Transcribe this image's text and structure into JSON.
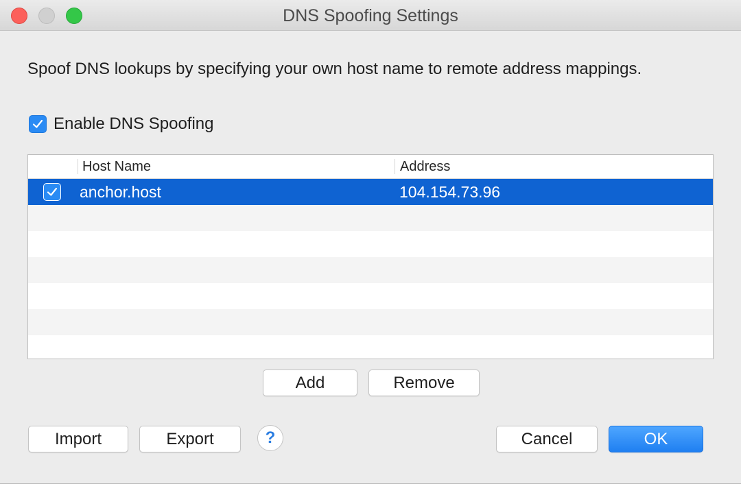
{
  "window": {
    "title": "DNS Spoofing Settings"
  },
  "description": "Spoof DNS lookups by specifying your own host name to remote address mappings.",
  "enable": {
    "label": "Enable DNS Spoofing",
    "checked": true
  },
  "table": {
    "columns": [
      "",
      "Host Name",
      "Address"
    ],
    "rows": [
      {
        "enabled": true,
        "host": "anchor.host",
        "address": "104.154.73.96",
        "selected": true
      }
    ]
  },
  "buttons": {
    "add": "Add",
    "remove": "Remove",
    "import": "Import",
    "export": "Export",
    "help": "?",
    "cancel": "Cancel",
    "ok": "OK"
  },
  "colors": {
    "accent": "#2a8bf4",
    "selection": "#0f63d2",
    "close": "#fc605b",
    "zoom": "#34c748"
  },
  "icons": {
    "checkbox": "checkmark-icon",
    "help": "question-icon"
  }
}
